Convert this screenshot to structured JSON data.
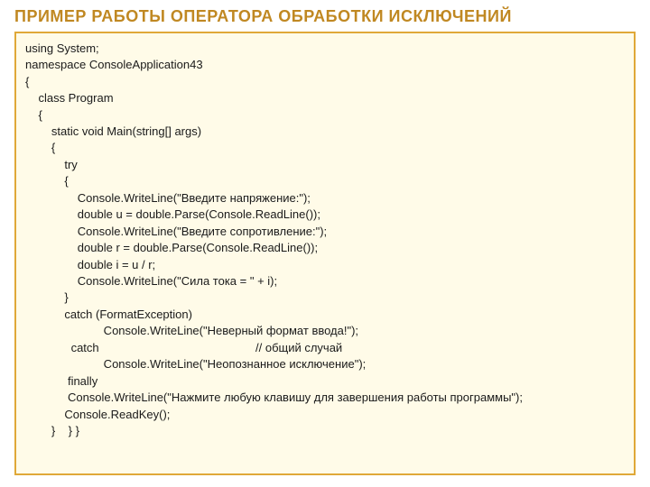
{
  "title": "ПРИМЕР РАБОТЫ ОПЕРАТОРА ОБРАБОТКИ ИСКЛЮЧЕНИЙ",
  "code": [
    "using System;",
    "namespace ConsoleApplication43",
    "{",
    "    class Program",
    "    {",
    "        static void Main(string[] args)",
    "        {",
    "            try",
    "            {",
    "                Console.WriteLine(\"Введите напряжение:\");",
    "                double u = double.Parse(Console.ReadLine());",
    "                Console.WriteLine(\"Введите сопротивление:\");",
    "                double r = double.Parse(Console.ReadLine());",
    "                double i = u / r;",
    "                Console.WriteLine(\"Сила тока = \" + i);",
    "            }",
    "            catch (FormatException)",
    "                        Console.WriteLine(\"Неверный формат ввода!\");",
    "              catch                                                // общий случай",
    "                        Console.WriteLine(\"Неопознанное исключение\");",
    "             finally",
    "             Console.WriteLine(\"Нажмите любую клавишу для завершения работы программы\");",
    "            Console.ReadKey();",
    "        }    } }"
  ]
}
